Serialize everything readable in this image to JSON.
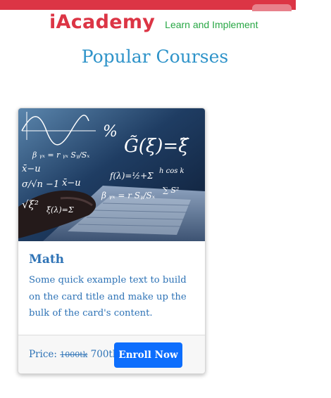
{
  "header": {
    "brand": "iAcademy",
    "tagline": "Learn and Implement"
  },
  "section": {
    "title": "Popular Courses"
  },
  "courses": [
    {
      "image_subject": "laptop-with-math-formulas",
      "title": "Math",
      "description": "Some quick example text to build on the card title and make up the bulk of the card's content.",
      "price_label": "Price:",
      "old_price": "1000tk",
      "new_price": "700tk",
      "button_label": "Enroll Now"
    }
  ],
  "colors": {
    "brand": "#dc3545",
    "tagline": "#28a745",
    "heading": "#2e93c9",
    "card_text": "#2e73b6",
    "button": "#0d6efd"
  }
}
